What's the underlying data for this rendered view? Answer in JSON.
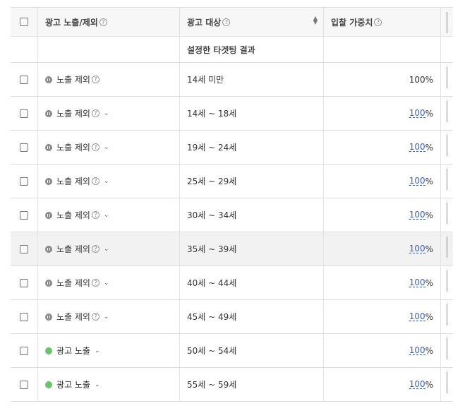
{
  "header": {
    "col_exposure": "광고 노출/제외",
    "col_target": "광고 대상",
    "col_bid": "입찰 가중치"
  },
  "subheader": {
    "target_result": "설정한 타겟팅 결과"
  },
  "rows": [
    {
      "status": "노출 제외",
      "status_type": "off",
      "dropdown": false,
      "target": "14세 미만",
      "bid": "100",
      "bid_link": false
    },
    {
      "status": "노출 제외",
      "status_type": "off",
      "dropdown": true,
      "target": "14세 ~ 18세",
      "bid": "100",
      "bid_link": true
    },
    {
      "status": "노출 제외",
      "status_type": "off",
      "dropdown": true,
      "target": "19세 ~ 24세",
      "bid": "100",
      "bid_link": true
    },
    {
      "status": "노출 제외",
      "status_type": "off",
      "dropdown": true,
      "target": "25세 ~ 29세",
      "bid": "100",
      "bid_link": true
    },
    {
      "status": "노출 제외",
      "status_type": "off",
      "dropdown": true,
      "target": "30세 ~ 34세",
      "bid": "100",
      "bid_link": true
    },
    {
      "status": "노출 제외",
      "status_type": "off",
      "dropdown": true,
      "target": "35세 ~ 39세",
      "bid": "100",
      "bid_link": true
    },
    {
      "status": "노출 제외",
      "status_type": "off",
      "dropdown": true,
      "target": "40세 ~ 44세",
      "bid": "100",
      "bid_link": true
    },
    {
      "status": "노출 제외",
      "status_type": "off",
      "dropdown": true,
      "target": "45세 ~ 49세",
      "bid": "100",
      "bid_link": true
    },
    {
      "status": "광고 노출",
      "status_type": "on",
      "dropdown": true,
      "target": "50세 ~ 54세",
      "bid": "100",
      "bid_link": true
    },
    {
      "status": "광고 노출",
      "status_type": "on",
      "dropdown": true,
      "target": "55세 ~ 59세",
      "bid": "100",
      "bid_link": true
    }
  ],
  "units": {
    "percent": "%"
  },
  "icons": {
    "help": "help-circle-icon",
    "dropdown": "chevron-down-icon",
    "sort": "sort-icon"
  },
  "colors": {
    "on": "#6ac46a",
    "off": "#8a8a8a",
    "link": "#3a62c8"
  }
}
